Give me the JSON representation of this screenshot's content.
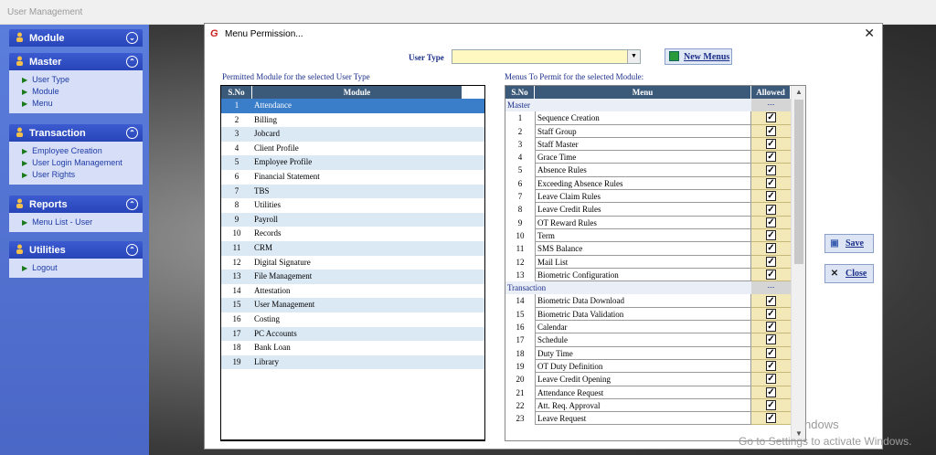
{
  "window": {
    "title": "User Management"
  },
  "sidebar": {
    "panels": [
      {
        "title": "Module",
        "toggle": "⌄",
        "items": []
      },
      {
        "title": "Master",
        "toggle": "⌃",
        "items": [
          "User Type",
          "Module",
          "Menu"
        ]
      },
      {
        "title": "Transaction",
        "toggle": "⌃",
        "items": [
          "Employee Creation",
          "User Login Management",
          "User Rights"
        ]
      },
      {
        "title": "Reports",
        "toggle": "⌃",
        "items": [
          "Menu List - User"
        ]
      },
      {
        "title": "Utilities",
        "toggle": "⌃",
        "items": [
          "Logout"
        ]
      }
    ]
  },
  "dialog": {
    "title": "Menu Permission...",
    "logo": "G",
    "close": "✕",
    "user_type_label": "User Type",
    "user_type_value": "",
    "new_menus_label": "New Menus",
    "left_caption": "Permitted Module for the selected User Type",
    "right_caption": "Menus To Permit for the selected Module:",
    "left_headers": [
      "S.No",
      "Module"
    ],
    "right_headers": [
      "S.No",
      "Menu",
      "Allowed"
    ],
    "modules": [
      [
        "1",
        "Attendance"
      ],
      [
        "2",
        "Billing"
      ],
      [
        "3",
        "Jobcard"
      ],
      [
        "4",
        "Client Profile"
      ],
      [
        "5",
        "Employee Profile"
      ],
      [
        "6",
        "Financial Statement"
      ],
      [
        "7",
        "TBS"
      ],
      [
        "8",
        "Utilities"
      ],
      [
        "9",
        "Payroll"
      ],
      [
        "10",
        "Records"
      ],
      [
        "11",
        "CRM"
      ],
      [
        "12",
        "Digital Signature"
      ],
      [
        "13",
        "File Management"
      ],
      [
        "14",
        "Attestation"
      ],
      [
        "15",
        "User Management"
      ],
      [
        "16",
        "Costing"
      ],
      [
        "17",
        "PC Accounts"
      ],
      [
        "18",
        "Bank Loan"
      ],
      [
        "19",
        "Library"
      ]
    ],
    "selected_module_index": 0,
    "menu_groups": [
      {
        "group": "Master",
        "dots": "....",
        "rows": [
          [
            "1",
            "Sequence Creation"
          ],
          [
            "2",
            "Staff Group"
          ],
          [
            "3",
            "Staff Master"
          ],
          [
            "4",
            "Grace Time"
          ],
          [
            "5",
            "Absence Rules"
          ],
          [
            "6",
            "Exceeding Absence Rules"
          ],
          [
            "7",
            "Leave Claim  Rules"
          ],
          [
            "8",
            "Leave Credit Rules"
          ],
          [
            "9",
            "OT Reward Rules"
          ],
          [
            "10",
            "Term"
          ],
          [
            "11",
            "SMS Balance"
          ],
          [
            "12",
            "Mail List"
          ],
          [
            "13",
            "Biometric Configuration"
          ]
        ]
      },
      {
        "group": "Transaction",
        "dots": "....",
        "rows": [
          [
            "14",
            "Biometric Data Download"
          ],
          [
            "15",
            "Biometric Data Validation"
          ],
          [
            "16",
            "Calendar"
          ],
          [
            "17",
            "Schedule"
          ],
          [
            "18",
            "Duty Time"
          ],
          [
            "19",
            "OT Duty Definition"
          ],
          [
            "20",
            "Leave Credit Opening"
          ],
          [
            "21",
            "Attendance Request"
          ],
          [
            "22",
            "Att. Req. Approval"
          ],
          [
            "23",
            "Leave Request"
          ]
        ]
      }
    ],
    "check_mark": "✓",
    "save_label": "Save",
    "close_label": "Close"
  },
  "watermark": {
    "line1": "ndows",
    "line2": "Go to Settings to activate Windows."
  }
}
